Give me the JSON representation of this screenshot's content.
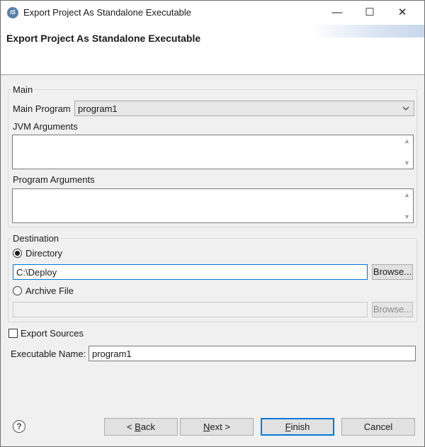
{
  "window": {
    "title": "Export Project As Standalone Executable",
    "app_icon_text": "IS",
    "minimize_glyph": "—",
    "maximize_glyph": "☐",
    "close_glyph": "✕"
  },
  "header": {
    "title": "Export Project As Standalone Executable"
  },
  "main_group": {
    "label": "Main",
    "main_program_label": "Main Program",
    "main_program_value": "program1",
    "jvm_arguments_label": "JVM Arguments",
    "jvm_arguments_value": "",
    "program_arguments_label": "Program Arguments",
    "program_arguments_value": ""
  },
  "destination_group": {
    "label": "Destination",
    "directory_label": "Directory",
    "directory_selected": true,
    "directory_value": "C:\\Deploy",
    "browse_label": "Browse...",
    "archive_label": "Archive File",
    "archive_selected": false,
    "archive_value": "",
    "browse_archive_label": "Browse..."
  },
  "export_sources": {
    "label": "Export Sources",
    "checked": false
  },
  "executable_name": {
    "label": "Executable Name:",
    "value": "program1"
  },
  "footer": {
    "help_glyph": "?",
    "back_prefix": "< ",
    "back_mnemonic": "B",
    "back_rest": "ack",
    "next_mnemonic": "N",
    "next_rest": "ext >",
    "finish_mnemonic": "F",
    "finish_rest": "inish",
    "cancel_label": "Cancel"
  },
  "icons": {
    "app": "app-logo-icon",
    "dropdown": "chevron-down-icon",
    "help": "help-icon"
  }
}
